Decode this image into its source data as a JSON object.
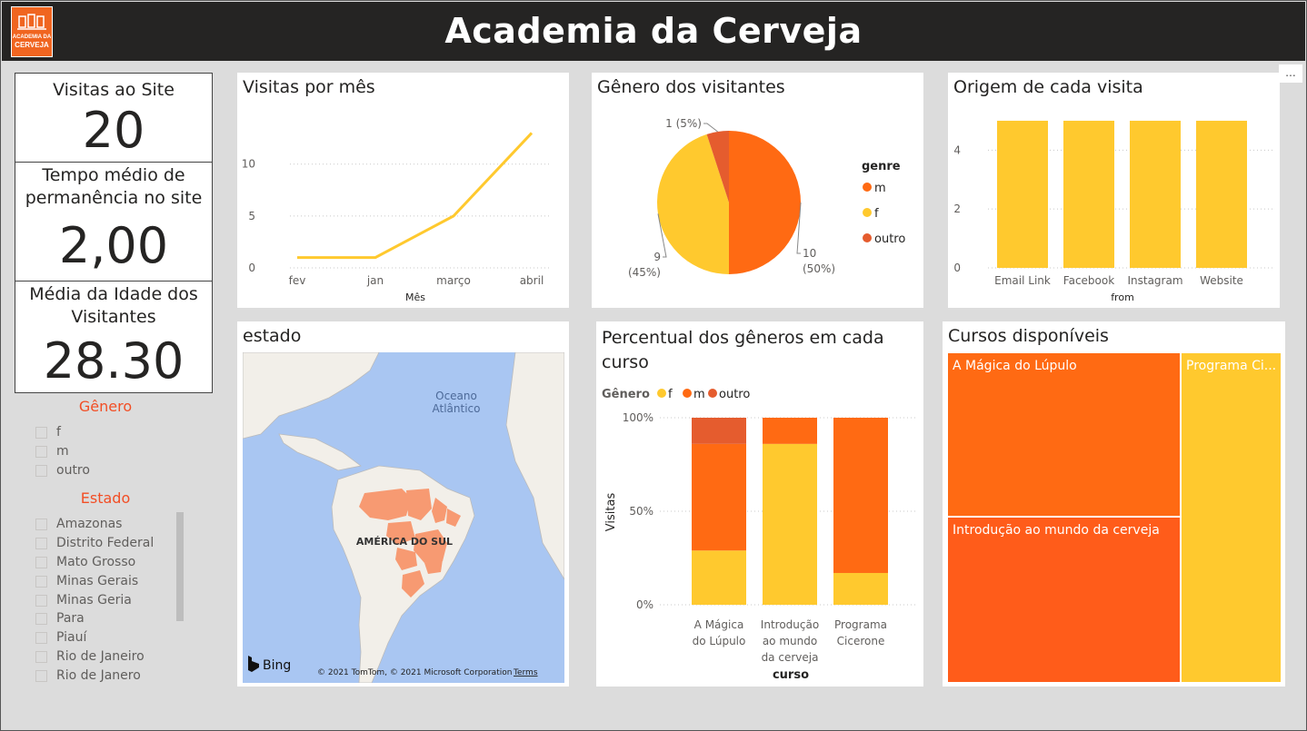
{
  "header": {
    "title": "Academia da Cerveja",
    "logo_text_1": "ACADEMIA DA",
    "logo_text_2": "CERVEJA",
    "more_options": "..."
  },
  "kpis": [
    {
      "label": "Visitas ao Site",
      "value": "20"
    },
    {
      "label": "Tempo médio de permanência no site",
      "value": "2,00"
    },
    {
      "label": "Média da Idade dos Visitantes",
      "value": "28.30"
    }
  ],
  "slicers": {
    "genero": {
      "title": "Gênero",
      "items": [
        "f",
        "m",
        "outro"
      ]
    },
    "estado": {
      "title": "Estado",
      "items": [
        "Amazonas",
        "Distrito Federal",
        "Mato Grosso",
        "Minas Gerais",
        "Minas Geria",
        "Para",
        "Piauí",
        "Rio de Janeiro",
        "Rio de Janero"
      ]
    }
  },
  "colors": {
    "m": "#ff6a13",
    "f": "#ffc92e",
    "outro": "#e55c2e",
    "line": "#ffc92e",
    "bar": "#ffc92e",
    "accent": "#f24e25",
    "header_bg": "#252423"
  },
  "visitas_card": {
    "title": "Visitas por mês"
  },
  "genero_card": {
    "title": "Gênero dos visitantes"
  },
  "origem_card": {
    "title": "Origem de cada visita"
  },
  "estado_card": {
    "title": "estado",
    "ocean_label_1": "Oceano",
    "ocean_label_2": "Atlântico",
    "continent_label": "AMÉRICA DO SUL",
    "bing": "Bing",
    "copyright": "© 2021 TomTom, © 2021 Microsoft Corporation",
    "terms": "Terms"
  },
  "percentual_card": {
    "title_1": "Percentual dos gêneros em cada",
    "title_2": "curso"
  },
  "cursos_card": {
    "title": "Cursos disponíveis"
  },
  "chart_data": [
    {
      "type": "line",
      "title": "Visitas por mês",
      "x": [
        "fev",
        "jan",
        "março",
        "abril"
      ],
      "xlabel": "Mês",
      "series": [
        {
          "values": [
            1,
            1,
            5,
            13
          ]
        }
      ],
      "ylim": [
        0,
        14
      ],
      "yticks": [
        "0",
        "5",
        "10"
      ],
      "grid": true
    },
    {
      "type": "pie",
      "title": "Gênero dos visitantes",
      "legend_title": "genre",
      "legend_position": "right",
      "slices": [
        {
          "name": "m",
          "value": 10,
          "label_1": "10",
          "label_2": "(50%)"
        },
        {
          "name": "f",
          "value": 9,
          "label_1": "9",
          "label_2": "(45%)"
        },
        {
          "name": "outro",
          "value": 1,
          "label_1": "1 (5%)",
          "label_2": ""
        }
      ]
    },
    {
      "type": "bar",
      "title": "Origem de cada visita",
      "categories": [
        "Email Link",
        "Facebook",
        "Instagram",
        "Website"
      ],
      "values": [
        5,
        5,
        5,
        5
      ],
      "xlabel": "from",
      "ylim": [
        0,
        5.4
      ],
      "yticks": [
        "0",
        "2",
        "4"
      ],
      "grid": true
    },
    {
      "type": "bar",
      "stacked": "percent",
      "title": "Percentual dos gêneros em cada curso",
      "legend_title": "Gênero",
      "legend_position": "top-left",
      "xlabel": "curso",
      "ylabel": "Visitas",
      "yticks": [
        "0%",
        "50%",
        "100%"
      ],
      "categories": [
        [
          "A Mágica",
          "do Lúpulo"
        ],
        [
          "Introdução",
          "ao mundo",
          "da cerveja"
        ],
        [
          "Programa",
          "Cicerone"
        ]
      ],
      "series": [
        {
          "name": "f",
          "values": [
            0.29,
            0.86,
            0.17
          ]
        },
        {
          "name": "m",
          "values": [
            0.57,
            0.14,
            0.83
          ]
        },
        {
          "name": "outro",
          "values": [
            0.14,
            0,
            0
          ]
        }
      ]
    },
    {
      "type": "treemap",
      "title": "Cursos disponíveis",
      "items": [
        {
          "name": "A Mágica do Lúpulo",
          "label": "A Mágica do Lúpulo",
          "value": 7,
          "color": "#ff6a13"
        },
        {
          "name": "Introdução ao mundo da cerveja",
          "label": "Introdução ao mundo da cerveja",
          "value": 7,
          "color": "#ff5c1a"
        },
        {
          "name": "Programa Cicerone",
          "label": "Programa Ci...",
          "value": 6,
          "color": "#ffc92e"
        }
      ]
    }
  ]
}
